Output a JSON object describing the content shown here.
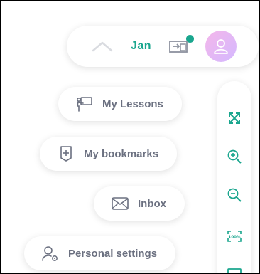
{
  "header": {
    "user_name": "Jan",
    "icons": {
      "collapse": "chevron-up-icon",
      "teach": "presentation-board-icon",
      "notification": "notification-dot",
      "avatar": "user-avatar-icon"
    },
    "colors": {
      "accent": "#1aa68e",
      "avatar_gradient_start": "#f4b6ea",
      "avatar_gradient_end": "#d4b9ff"
    }
  },
  "menu": {
    "items": [
      {
        "label": "My Lessons",
        "icon": "lesson-board-icon"
      },
      {
        "label": "My bookmarks",
        "icon": "bookmark-plus-icon"
      },
      {
        "label": "Inbox",
        "icon": "mail-icon"
      },
      {
        "label": "Personal settings",
        "icon": "user-settings-icon"
      }
    ]
  },
  "view_controls": {
    "items": [
      {
        "icon": "fullscreen-arrows-icon"
      },
      {
        "icon": "zoom-in-icon"
      },
      {
        "icon": "zoom-out-icon"
      },
      {
        "icon": "zoom-100-icon",
        "label": "100%"
      },
      {
        "icon": "screen-icon"
      }
    ]
  }
}
